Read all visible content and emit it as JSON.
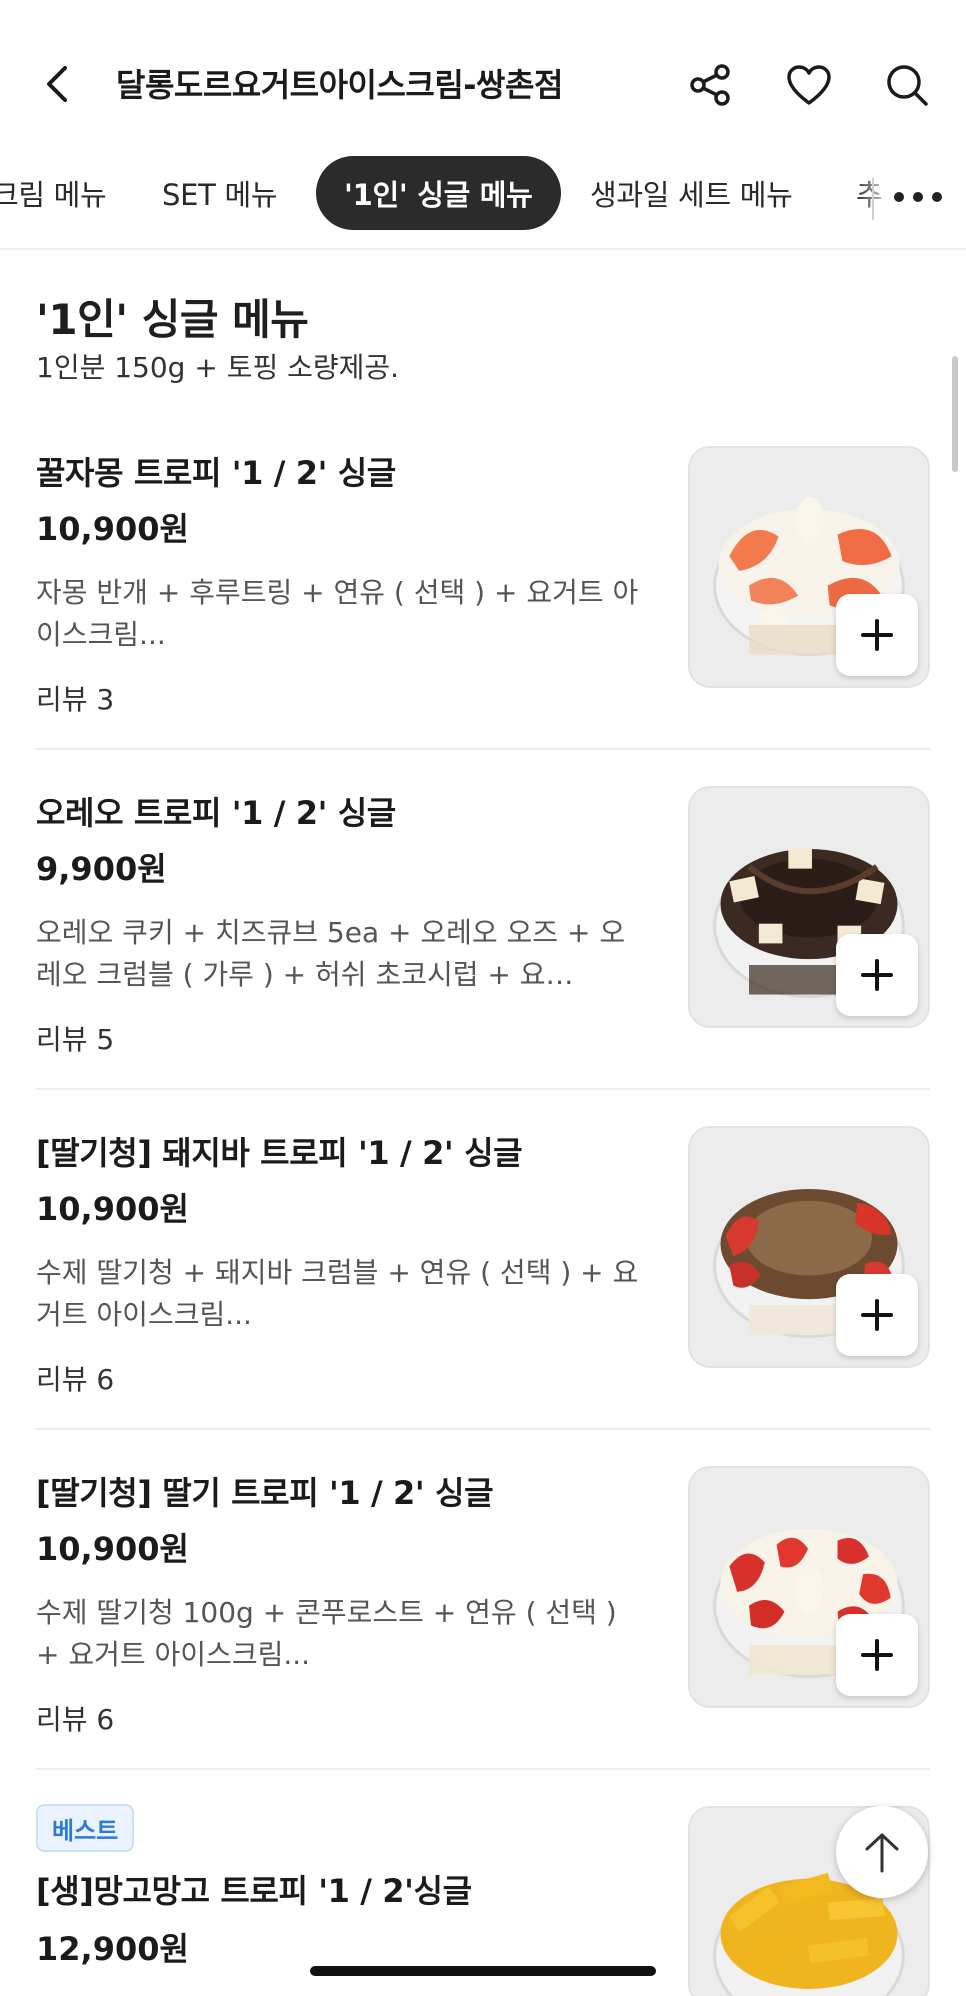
{
  "header": {
    "title": "달롱도르요거트아이스크림-쌍촌점",
    "icons": [
      "back-icon",
      "share-icon",
      "heart-icon",
      "search-icon"
    ]
  },
  "tabs": [
    {
      "label": "크림 메뉴"
    },
    {
      "label": "SET 메뉴"
    },
    {
      "label": "'1인' 싱글 메뉴",
      "active": true
    },
    {
      "label": "생과일 세트 메뉴"
    },
    {
      "label": "추"
    }
  ],
  "section": {
    "title": "'1인' 싱글 메뉴",
    "subtitle": "1인분 150g + 토핑 소량제공."
  },
  "items": [
    {
      "name": "꿀자몽 트로피 '1 / 2' 싱글",
      "price": "10,900원",
      "desc": "자몽 반개 + 후루트링 + 연유 ( 선택 ) + 요거트 아이스크림...",
      "review": "리뷰 3"
    },
    {
      "name": "오레오 트로피 '1 / 2' 싱글",
      "price": "9,900원",
      "desc": "오레오 쿠키 + 치즈큐브 5ea + 오레오 오즈 + 오레오 크럼블 ( 가루 ) + 허쉬 초코시럽 + 요…",
      "review": "리뷰 5"
    },
    {
      "name": "[딸기청]  돼지바 트로피 '1 / 2' 싱글",
      "price": "10,900원",
      "desc": "수제 딸기청 + 돼지바 크럼블 + 연유 ( 선택 ) + 요거트 아이스크림...",
      "review": "리뷰 6"
    },
    {
      "name": "[딸기청]  딸기 트로피 '1 / 2' 싱글",
      "price": "10,900원",
      "desc": "수제 딸기청 100g + 콘푸로스트 + 연유 ( 선택 ) + 요거트 아이스크림...",
      "review": "리뷰 6"
    },
    {
      "badge": "베스트",
      "name": "[생]망고망고 트로피 '1 / 2'싱글",
      "price": "12,900원"
    }
  ],
  "colors": {
    "active_tab_bg": "#2b2b2b",
    "badge_text": "#2b7bd6",
    "badge_bg": "#eaf3fd"
  }
}
